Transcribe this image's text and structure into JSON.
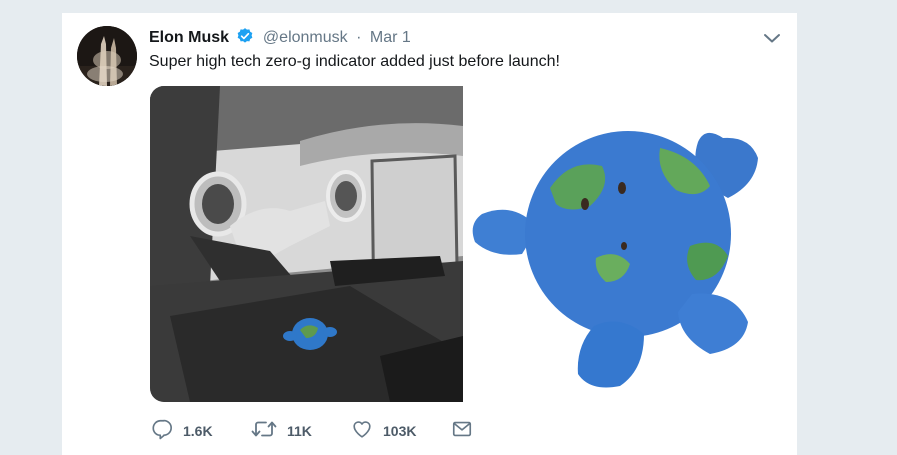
{
  "tweet": {
    "display_name": "Elon Musk",
    "handle": "@elonmusk",
    "separator": "·",
    "date": "Mar 1",
    "text": "Super high tech zero-g indicator added just before launch!",
    "verified": true
  },
  "icons": {
    "verified": "verified-badge-icon",
    "menu": "chevron-down-icon",
    "reply": "reply-icon",
    "retweet": "retweet-icon",
    "like": "heart-icon",
    "message": "envelope-icon"
  },
  "actions": {
    "replies": "1.6K",
    "retweets": "11K",
    "likes": "103K"
  },
  "colors": {
    "accent": "#1da1f2",
    "text": "#14171a",
    "secondary": "#657786",
    "page_background": "#e6ecf0"
  }
}
